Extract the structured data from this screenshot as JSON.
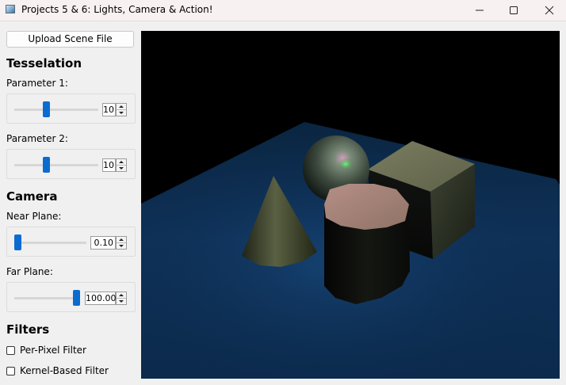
{
  "window": {
    "title": "Projects 5 & 6: Lights, Camera & Action!",
    "icon": "app-window-icon"
  },
  "sidebar": {
    "upload_button": "Upload Scene File",
    "tesselation": {
      "heading": "Tesselation",
      "param1": {
        "label": "Parameter 1:",
        "value": "10",
        "slider_fraction": 0.38
      },
      "param2": {
        "label": "Parameter 2:",
        "value": "10",
        "slider_fraction": 0.38
      }
    },
    "camera": {
      "heading": "Camera",
      "near_plane": {
        "label": "Near Plane:",
        "value": "0.10",
        "slider_fraction": 0.0
      },
      "far_plane": {
        "label": "Far Plane:",
        "value": "100.00",
        "slider_fraction": 1.0
      }
    },
    "filters": {
      "heading": "Filters",
      "per_pixel": {
        "label": "Per-Pixel Filter",
        "checked": false
      },
      "kernel_based": {
        "label": "Kernel-Based Filter",
        "checked": false
      }
    }
  },
  "colors": {
    "accent": "#0b6cd0",
    "viewport_background": "#000000",
    "floor": "#0f3158"
  }
}
